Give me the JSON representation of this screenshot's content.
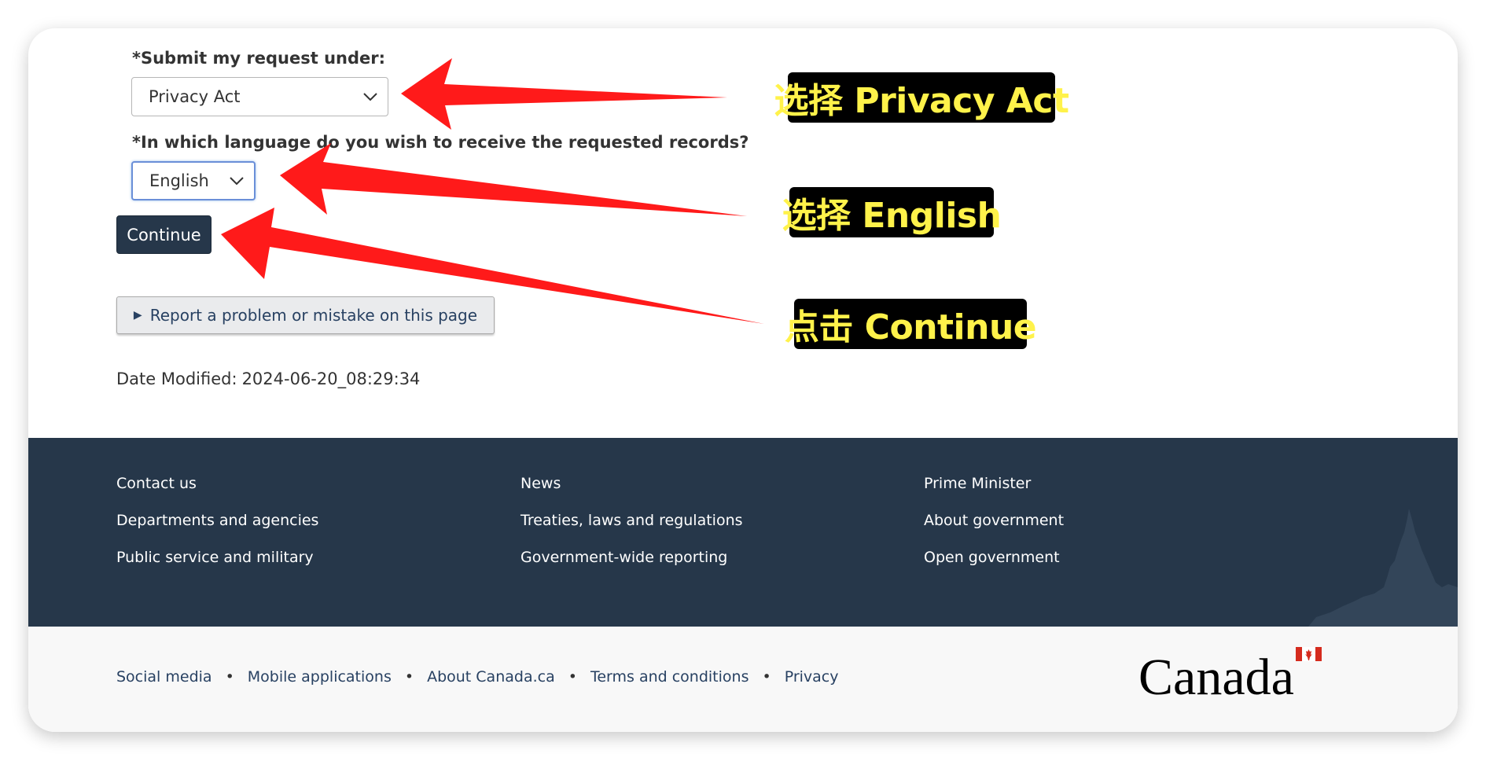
{
  "form": {
    "request_label": "*Submit my request under:",
    "request_value": "Privacy Act",
    "language_label": "*In which language do you wish to receive the requested records?",
    "language_value": "English",
    "continue_label": "Continue",
    "report_label": "Report a problem or mistake on this page",
    "date_label": "Date Modified:",
    "date_value": "2024-06-20_08:29:34"
  },
  "footer": {
    "col1": [
      "Contact us",
      "Departments and agencies",
      "Public service and military"
    ],
    "col2": [
      "News",
      "Treaties, laws and regulations",
      "Government-wide reporting"
    ],
    "col3": [
      "Prime Minister",
      "About government",
      "Open government"
    ],
    "sub_links": [
      "Social media",
      "Mobile applications",
      "About Canada.ca",
      "Terms and conditions",
      "Privacy"
    ],
    "wordmark": "Canada"
  },
  "annotations": [
    {
      "text": "选择 Privacy Act"
    },
    {
      "text": "选择 English"
    },
    {
      "text": "点击 Continue"
    }
  ],
  "colors": {
    "footer_bg": "#26374a",
    "primary_button": "#26374a",
    "arrow": "#ff0000",
    "annotation_text": "#fff24a",
    "annotation_bg": "#000000",
    "flag_red": "#d52b1e"
  },
  "icons": [
    "chevron-down-icon",
    "triangle-right-icon",
    "canada-flag-icon",
    "parliament-silhouette-icon"
  ]
}
